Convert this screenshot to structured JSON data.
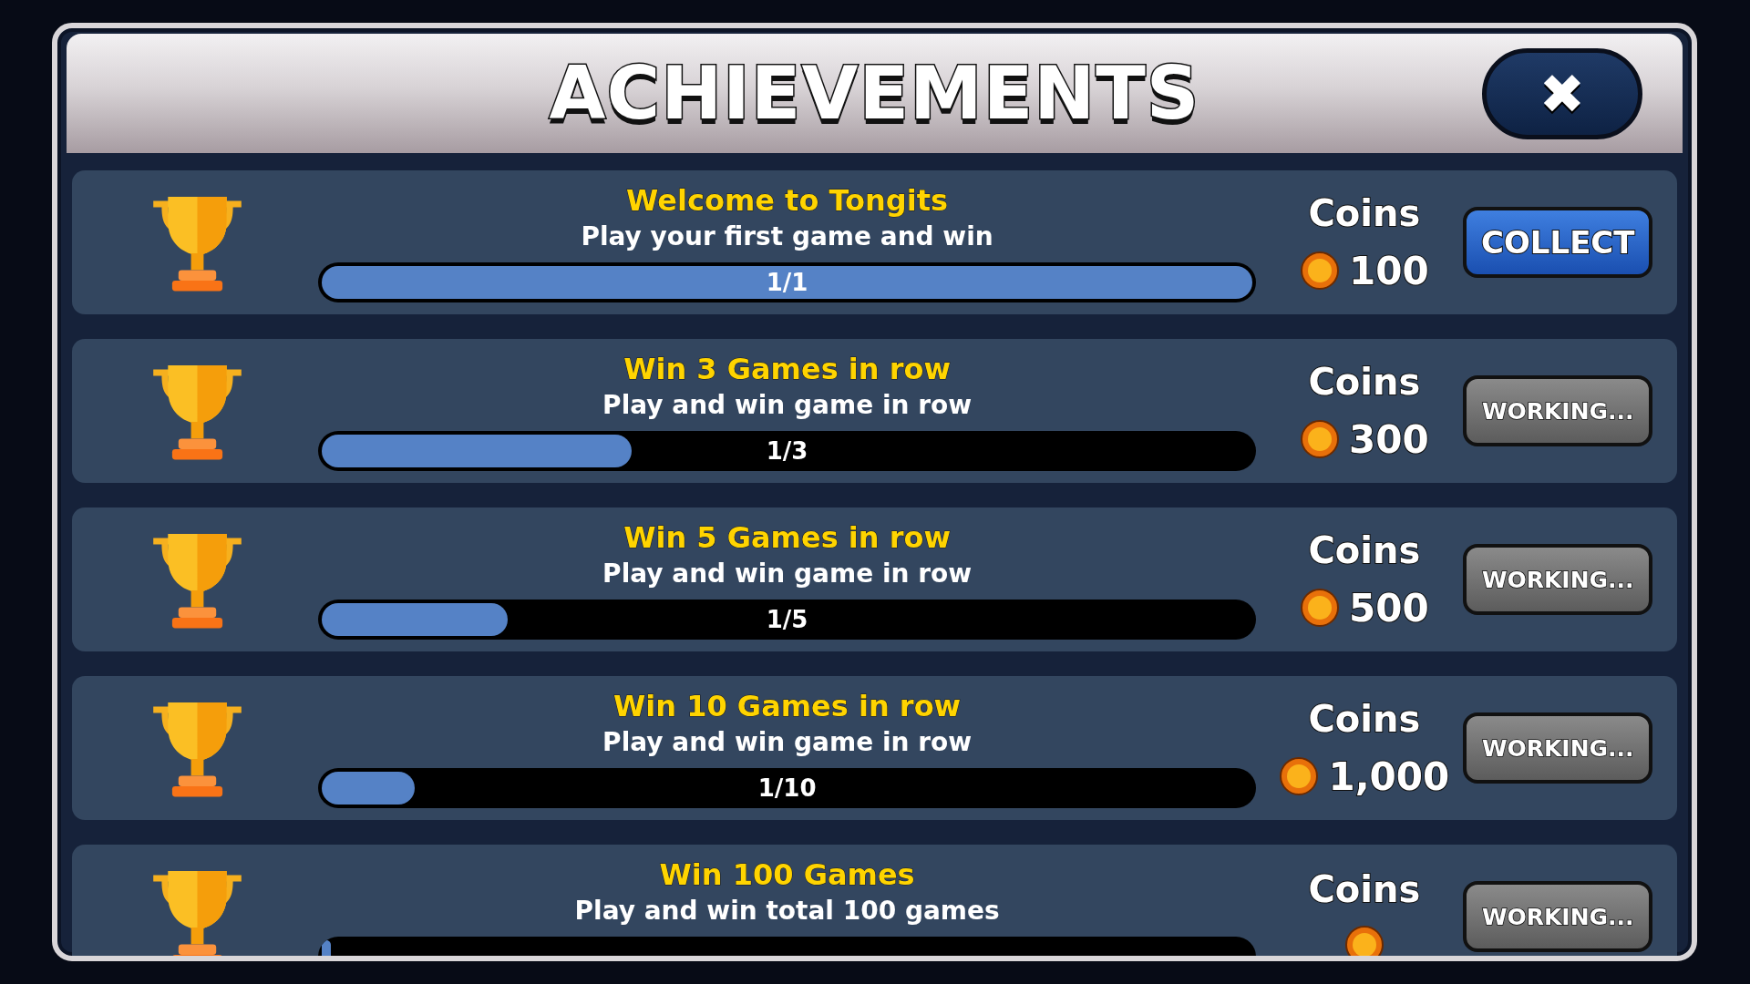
{
  "title": "ACHIEVEMENTS",
  "close_button": {
    "label": "✖"
  },
  "achievements": [
    {
      "title": "Welcome to Tongits",
      "description": "Play your first game and win",
      "level": 1,
      "progress": "1/1",
      "reward_label": "Coins",
      "reward": "100",
      "action": {
        "label": "COLLECT",
        "kind": "collect"
      }
    },
    {
      "title": "Win 3 Games in row",
      "description": "Play and win game in row",
      "level": 0.333,
      "progress": "1/3",
      "reward_label": "Coins",
      "reward": "300",
      "action": {
        "label": "WORKING...",
        "kind": "working"
      }
    },
    {
      "title": "Win 5 Games in row",
      "description": "Play and win game in row",
      "level": 0.2,
      "progress": "1/5",
      "reward_label": "Coins",
      "reward": "500",
      "action": {
        "label": "WORKING...",
        "kind": "working"
      }
    },
    {
      "title": "Win 10 Games in row",
      "description": "Play and win game in row",
      "level": 0.1,
      "progress": "1/10",
      "reward_label": "Coins",
      "reward": "1,000",
      "action": {
        "label": "WORKING...",
        "kind": "working"
      }
    },
    {
      "title": "Win 100 Games",
      "description": "Play and win total 100 games",
      "level": 0.01,
      "reward_label": "Coins",
      "action": {
        "label": "WORKING...",
        "kind": "working"
      }
    }
  ]
}
